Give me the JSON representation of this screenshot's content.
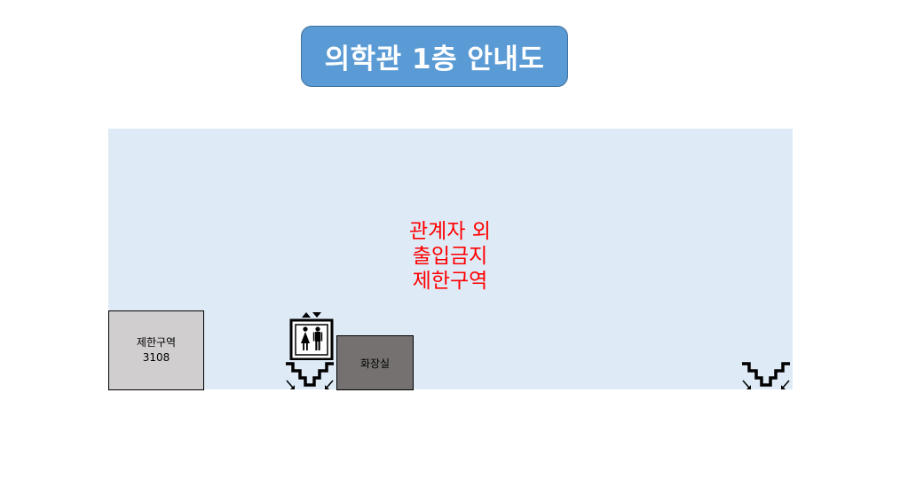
{
  "title": "의학관 1층 안내도",
  "notice": {
    "lines": [
      "관계자 외",
      "출입금지",
      "제한구역"
    ],
    "color": "#ff0000"
  },
  "rooms": {
    "restricted": {
      "label": "제한구역",
      "number": "3108"
    },
    "restroom": {
      "label": "화장실"
    }
  },
  "icons": {
    "elevator": "elevator-icon",
    "stairs": "stairs-icon"
  },
  "colors": {
    "title_bg": "#5b9bd5",
    "floor_bg": "#deebf7",
    "restricted_bg": "#d0cece",
    "restroom_bg": "#767171"
  }
}
